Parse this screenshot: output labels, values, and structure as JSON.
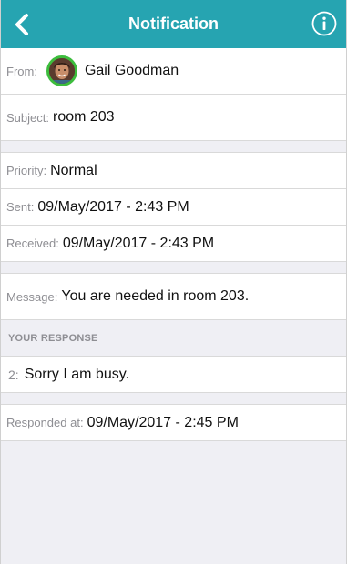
{
  "header": {
    "title": "Notification",
    "back_icon": "chevron-left-icon",
    "info_icon": "info-circle-icon"
  },
  "colors": {
    "header_bg": "#26a4b1",
    "avatar_ring": "#3dbd3d",
    "background": "#efeff4"
  },
  "from": {
    "label": "From:",
    "name": "Gail Goodman"
  },
  "subject": {
    "label": "Subject:",
    "value": "room 203"
  },
  "priority": {
    "label": "Priority:",
    "value": "Normal"
  },
  "sent": {
    "label": "Sent:",
    "value": "09/May/2017 - 2:43 PM"
  },
  "received": {
    "label": "Received:",
    "value": "09/May/2017 - 2:43 PM"
  },
  "message": {
    "label": "Message:",
    "value": "You are needed in room 203."
  },
  "response": {
    "section_title": "YOUR RESPONSE",
    "index": "2:",
    "value": "Sorry I am busy."
  },
  "responded": {
    "label": "Responded at:",
    "value": "09/May/2017 - 2:45 PM"
  }
}
